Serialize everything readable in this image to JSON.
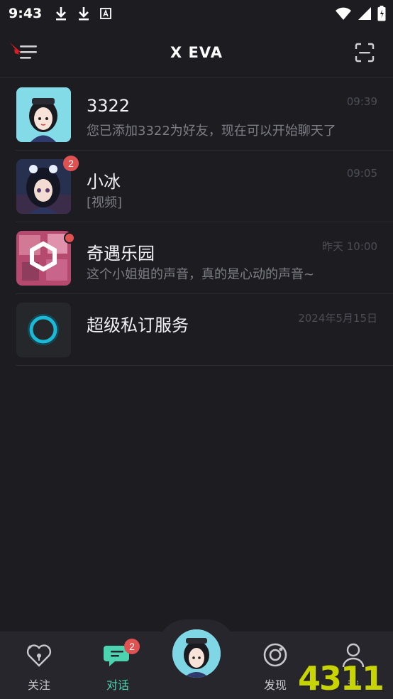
{
  "status_bar": {
    "time": "9:43"
  },
  "header": {
    "title": "X EVA"
  },
  "chats": [
    {
      "name": "3322",
      "preview": "您已添加3322为好友，现在可以开始聊天了",
      "time": "09:39"
    },
    {
      "name": "小冰",
      "preview": "[视频]",
      "time": "09:05",
      "badge": "2"
    },
    {
      "name": "奇遇乐园",
      "preview": "这个小姐姐的声音，真的是心动的声音~",
      "time": "昨天 10:00"
    },
    {
      "name": "超级私订服务",
      "preview": "",
      "time": "2024年5月15日"
    }
  ],
  "tabs": {
    "follow": "关注",
    "chat": "对话",
    "chat_badge": "2",
    "discover": "发现",
    "me": "我"
  },
  "colors": {
    "background": "#1c1c21",
    "accent": "#4cd3b0",
    "badge": "#e05252",
    "tabbar": "#26262c"
  },
  "watermark": "4311"
}
